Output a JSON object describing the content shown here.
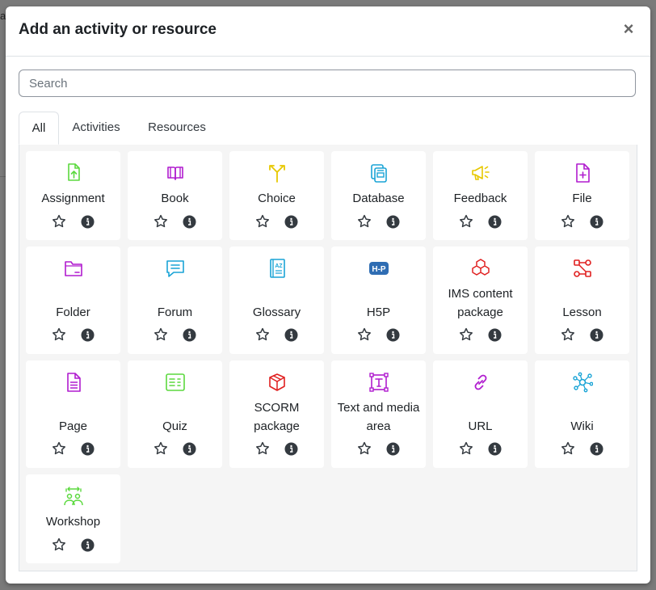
{
  "modal": {
    "title": "Add an activity or resource",
    "close_symbol": "×"
  },
  "search": {
    "placeholder": "Search",
    "value": ""
  },
  "tabs": [
    {
      "label": "All",
      "active": true
    },
    {
      "label": "Activities",
      "active": false
    },
    {
      "label": "Resources",
      "active": false
    }
  ],
  "items": [
    {
      "label": "Assignment",
      "icon": "assignment-icon",
      "color": "#5bd93e"
    },
    {
      "label": "Book",
      "icon": "book-icon",
      "color": "#b01ccf"
    },
    {
      "label": "Choice",
      "icon": "choice-icon",
      "color": "#e7c800"
    },
    {
      "label": "Database",
      "icon": "database-icon",
      "color": "#1aa4d6"
    },
    {
      "label": "Feedback",
      "icon": "feedback-icon",
      "color": "#e7c800"
    },
    {
      "label": "File",
      "icon": "file-icon",
      "color": "#b01ccf"
    },
    {
      "label": "Folder",
      "icon": "folder-icon",
      "color": "#b01ccf"
    },
    {
      "label": "Forum",
      "icon": "forum-icon",
      "color": "#1aa4d6"
    },
    {
      "label": "Glossary",
      "icon": "glossary-icon",
      "color": "#1aa4d6"
    },
    {
      "label": "H5P",
      "icon": "h5p-icon",
      "color": "#2f6db3"
    },
    {
      "label": "IMS content package",
      "icon": "ims-package-icon",
      "color": "#e02020"
    },
    {
      "label": "Lesson",
      "icon": "lesson-icon",
      "color": "#e02020"
    },
    {
      "label": "Page",
      "icon": "page-icon",
      "color": "#b01ccf"
    },
    {
      "label": "Quiz",
      "icon": "quiz-icon",
      "color": "#5bd93e"
    },
    {
      "label": "SCORM package",
      "icon": "scorm-icon",
      "color": "#e02020"
    },
    {
      "label": "Text and media area",
      "icon": "text-media-icon",
      "color": "#b01ccf"
    },
    {
      "label": "URL",
      "icon": "url-icon",
      "color": "#b01ccf"
    },
    {
      "label": "Wiki",
      "icon": "wiki-icon",
      "color": "#1aa4d6"
    },
    {
      "label": "Workshop",
      "icon": "workshop-icon",
      "color": "#5bd93e"
    }
  ]
}
